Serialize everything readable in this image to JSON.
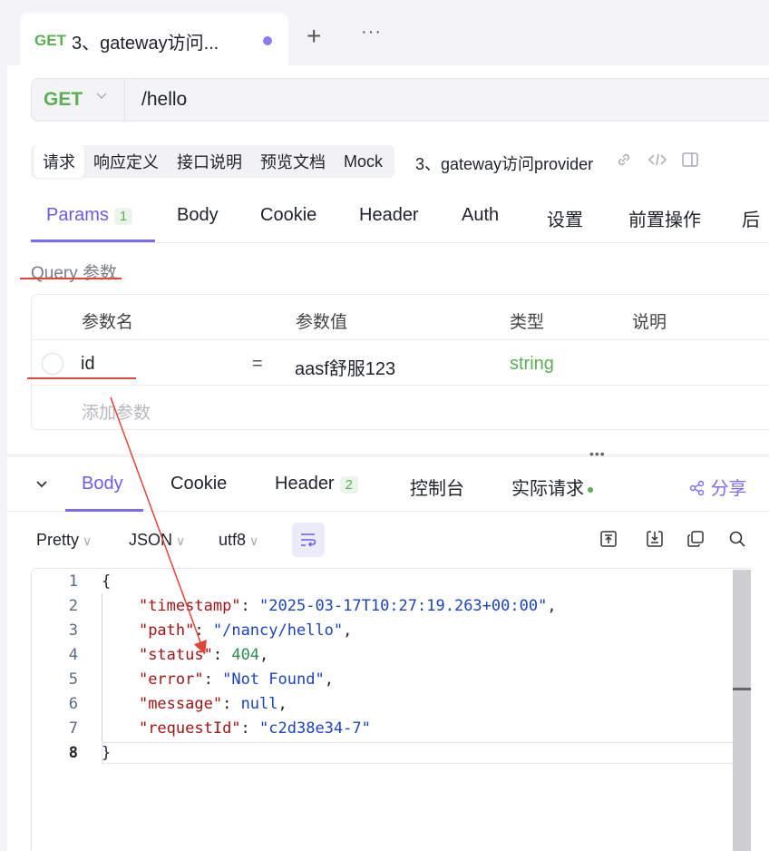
{
  "tab": {
    "method": "GET",
    "title": "3、gateway访问...",
    "plus": "+",
    "more": "···"
  },
  "url": {
    "method": "GET",
    "path": "/hello"
  },
  "subtabs": [
    "请求",
    "响应定义",
    "接口说明",
    "预览文档",
    "Mock"
  ],
  "endpoint_title": "3、gateway访问provider",
  "request_tabs": {
    "params": "Params",
    "params_count": "1",
    "body": "Body",
    "cookie": "Cookie",
    "header": "Header",
    "auth": "Auth",
    "settings": "设置",
    "pre": "前置操作",
    "post": "后"
  },
  "query": {
    "label": "Query 参数",
    "headers": [
      "参数名",
      "参数值",
      "类型",
      "说明"
    ],
    "row": {
      "name": "id",
      "eq": "=",
      "value": "aasf舒服123",
      "type": "string"
    },
    "add": "添加参数"
  },
  "response_tabs": {
    "body": "Body",
    "cookie": "Cookie",
    "header": "Header",
    "header_count": "2",
    "console": "控制台",
    "actual": "实际请求",
    "share": "分享"
  },
  "format": {
    "pretty": "Pretty",
    "json": "JSON",
    "encoding": "utf8"
  },
  "code": {
    "lines": [
      "1",
      "2",
      "3",
      "4",
      "5",
      "6",
      "7",
      "8"
    ],
    "open": "{",
    "close": "}",
    "k_timestamp": "\"timestamp\"",
    "v_timestamp": "\"2025-03-17T10:27:19.263+00:00\"",
    "k_path": "\"path\"",
    "v_path": "\"/nancy/hello\"",
    "k_status": "\"status\"",
    "v_status": "404",
    "k_error": "\"error\"",
    "v_error": "\"Not Found\"",
    "k_message": "\"message\"",
    "v_message": "null",
    "k_request": "\"requestId\"",
    "v_request": "\"c2d38e34-7\""
  },
  "colors": {
    "accent": "#7b6cf0",
    "get": "#5cae55",
    "annotation": "#e0453a"
  }
}
